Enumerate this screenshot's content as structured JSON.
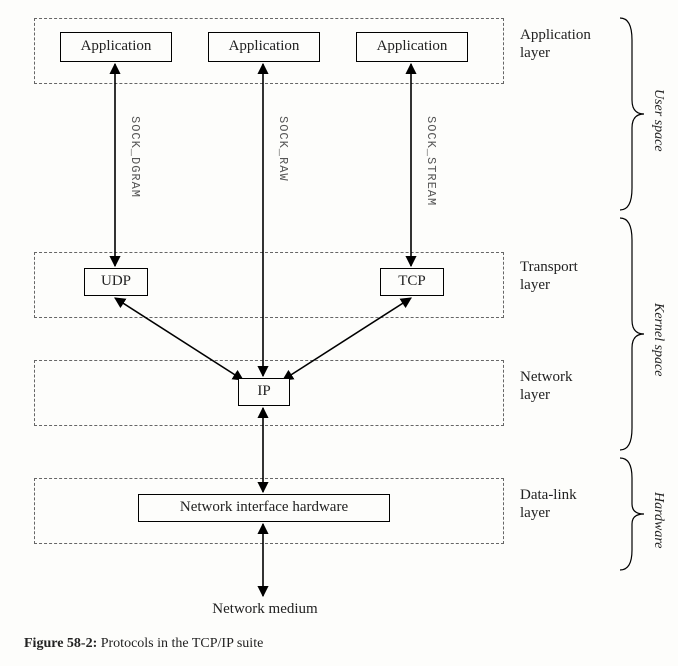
{
  "layers": {
    "application": {
      "label": "Application\nlayer"
    },
    "transport": {
      "label": "Transport\nlayer"
    },
    "network": {
      "label": "Network\nlayer"
    },
    "datalink": {
      "label": "Data-link\nlayer"
    }
  },
  "nodes": {
    "app1": "Application",
    "app2": "Application",
    "app3": "Application",
    "udp": "UDP",
    "tcp": "TCP",
    "ip": "IP",
    "nih": "Network interface hardware"
  },
  "sockets": {
    "dgram": "SOCK_DGRAM",
    "raw": "SOCK_RAW",
    "stream": "SOCK_STREAM"
  },
  "spaces": {
    "user": "User space",
    "kernel": "Kernel space",
    "hw": "Hardware"
  },
  "medium_label": "Network medium",
  "caption": {
    "fig": "Figure 58-2:",
    "text": " Protocols in the TCP/IP suite"
  }
}
